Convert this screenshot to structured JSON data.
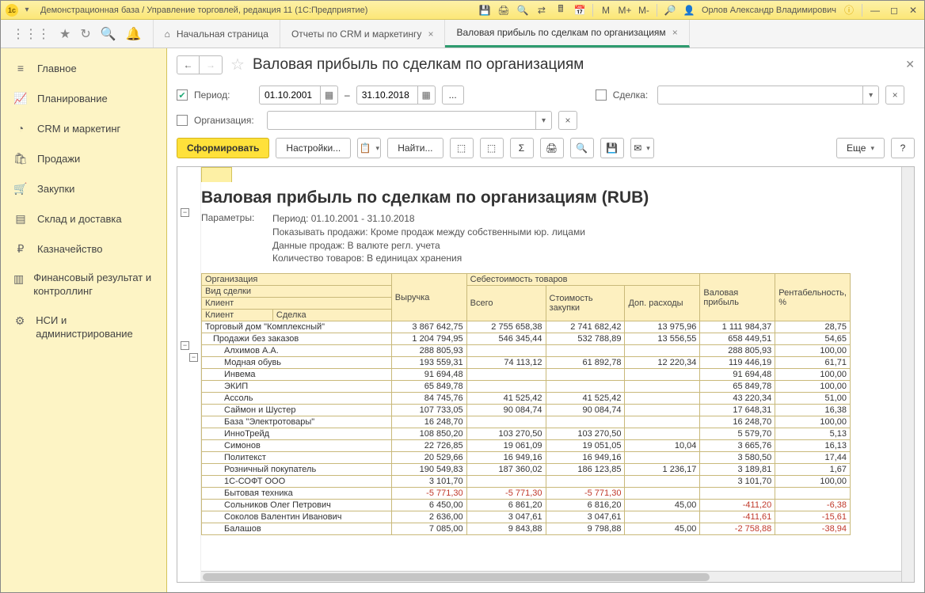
{
  "titlebar": {
    "title": "Демонстрационная база / Управление торговлей, редакция 11  (1С:Предприятие)",
    "user": "Орлов Александр Владимирович",
    "m_lbl": "M",
    "mplus": "M+",
    "mminus": "M-"
  },
  "maintabs": {
    "home": "Начальная страница",
    "t1": "Отчеты по CRM и маркетингу",
    "t2": "Валовая прибыль по сделкам по организациям"
  },
  "sidebar": {
    "items": [
      {
        "label": "Главное",
        "icon": "≡"
      },
      {
        "label": "Планирование",
        "icon": "📈"
      },
      {
        "label": "CRM и маркетинг",
        "icon": "◔"
      },
      {
        "label": "Продажи",
        "icon": "🛍"
      },
      {
        "label": "Закупки",
        "icon": "🛒"
      },
      {
        "label": "Склад и доставка",
        "icon": "▤"
      },
      {
        "label": "Казначейство",
        "icon": "₽"
      },
      {
        "label": "Финансовый результат и контроллинг",
        "icon": "▥"
      },
      {
        "label": "НСИ и администрирование",
        "icon": "⚙"
      }
    ]
  },
  "page": {
    "title": "Валовая прибыль по сделкам по организациям"
  },
  "filters": {
    "period_label": "Период:",
    "date_from": "01.10.2001",
    "date_to": "31.10.2018",
    "dash": "–",
    "dots": "...",
    "org_label": "Организация:",
    "deal_label": "Сделка:"
  },
  "toolbar": {
    "generate": "Сформировать",
    "settings": "Настройки...",
    "find": "Найти...",
    "more": "Еще",
    "help": "?"
  },
  "report": {
    "title": "Валовая прибыль по сделкам по организациям (RUB)",
    "params_label": "Параметры:",
    "params": [
      "Период: 01.10.2001 - 31.10.2018",
      "Показывать продажи: Кроме продаж между собственными юр. лицами",
      "Данные продаж: В валюте регл. учета",
      "Количество товаров: В единицах хранения"
    ],
    "headers": {
      "org": "Организация",
      "deal_type": "Вид сделки",
      "client": "Клиент",
      "deal": "Сделка",
      "revenue": "Выручка",
      "cost": "Себестоимость товаров",
      "total": "Всего",
      "purchase": "Стоимость закупки",
      "extra": "Доп. расходы",
      "gross": "Валовая прибыль",
      "margin": "Рентабельность, %"
    },
    "rows": [
      {
        "lvl": 0,
        "name": "Торговый дом \"Комплексный\"",
        "rev": "3 867 642,75",
        "tot": "2 755 658,38",
        "pur": "2 741 682,42",
        "ext": "13 975,96",
        "gp": "1 111 984,37",
        "mar": "28,75"
      },
      {
        "lvl": 1,
        "name": "Продажи без заказов",
        "rev": "1 204 794,95",
        "tot": "546 345,44",
        "pur": "532 788,89",
        "ext": "13 556,55",
        "gp": "658 449,51",
        "mar": "54,65"
      },
      {
        "lvl": 2,
        "name": "Алхимов А.А.",
        "rev": "288 805,93",
        "tot": "",
        "pur": "",
        "ext": "",
        "gp": "288 805,93",
        "mar": "100,00"
      },
      {
        "lvl": 2,
        "name": "Модная обувь",
        "rev": "193 559,31",
        "tot": "74 113,12",
        "pur": "61 892,78",
        "ext": "12 220,34",
        "gp": "119 446,19",
        "mar": "61,71"
      },
      {
        "lvl": 2,
        "name": "Инвема",
        "rev": "91 694,48",
        "tot": "",
        "pur": "",
        "ext": "",
        "gp": "91 694,48",
        "mar": "100,00"
      },
      {
        "lvl": 2,
        "name": "ЭКИП",
        "rev": "65 849,78",
        "tot": "",
        "pur": "",
        "ext": "",
        "gp": "65 849,78",
        "mar": "100,00"
      },
      {
        "lvl": 2,
        "name": "Ассоль",
        "rev": "84 745,76",
        "tot": "41 525,42",
        "pur": "41 525,42",
        "ext": "",
        "gp": "43 220,34",
        "mar": "51,00"
      },
      {
        "lvl": 2,
        "name": "Саймон и Шустер",
        "rev": "107 733,05",
        "tot": "90 084,74",
        "pur": "90 084,74",
        "ext": "",
        "gp": "17 648,31",
        "mar": "16,38"
      },
      {
        "lvl": 2,
        "name": "База \"Электротовары\"",
        "rev": "16 248,70",
        "tot": "",
        "pur": "",
        "ext": "",
        "gp": "16 248,70",
        "mar": "100,00"
      },
      {
        "lvl": 2,
        "name": "ИнноТрейд",
        "rev": "108 850,20",
        "tot": "103 270,50",
        "pur": "103 270,50",
        "ext": "",
        "gp": "5 579,70",
        "mar": "5,13"
      },
      {
        "lvl": 2,
        "name": "Симонов",
        "rev": "22 726,85",
        "tot": "19 061,09",
        "pur": "19 051,05",
        "ext": "10,04",
        "gp": "3 665,76",
        "mar": "16,13"
      },
      {
        "lvl": 2,
        "name": "Политекст",
        "rev": "20 529,66",
        "tot": "16 949,16",
        "pur": "16 949,16",
        "ext": "",
        "gp": "3 580,50",
        "mar": "17,44"
      },
      {
        "lvl": 2,
        "name": "Розничный покупатель",
        "rev": "190 549,83",
        "tot": "187 360,02",
        "pur": "186 123,85",
        "ext": "1 236,17",
        "gp": "3 189,81",
        "mar": "1,67"
      },
      {
        "lvl": 2,
        "name": "1С-СОФТ ООО",
        "rev": "3 101,70",
        "tot": "",
        "pur": "",
        "ext": "",
        "gp": "3 101,70",
        "mar": "100,00"
      },
      {
        "lvl": 2,
        "name": "Бытовая техника",
        "rev": "-5 771,30",
        "tot": "-5 771,30",
        "pur": "-5 771,30",
        "ext": "",
        "gp": "",
        "mar": "",
        "neg": true
      },
      {
        "lvl": 2,
        "name": "Сольников Олег Петрович",
        "rev": "6 450,00",
        "tot": "6 861,20",
        "pur": "6 816,20",
        "ext": "45,00",
        "gp": "-411,20",
        "mar": "-6,38",
        "neggp": true
      },
      {
        "lvl": 2,
        "name": "Соколов Валентин Иванович",
        "rev": "2 636,00",
        "tot": "3 047,61",
        "pur": "3 047,61",
        "ext": "",
        "gp": "-411,61",
        "mar": "-15,61",
        "neggp": true
      },
      {
        "lvl": 2,
        "name": "Балашов",
        "rev": "7 085,00",
        "tot": "9 843,88",
        "pur": "9 798,88",
        "ext": "45,00",
        "gp": "-2 758,88",
        "mar": "-38,94",
        "neggp": true
      }
    ]
  }
}
